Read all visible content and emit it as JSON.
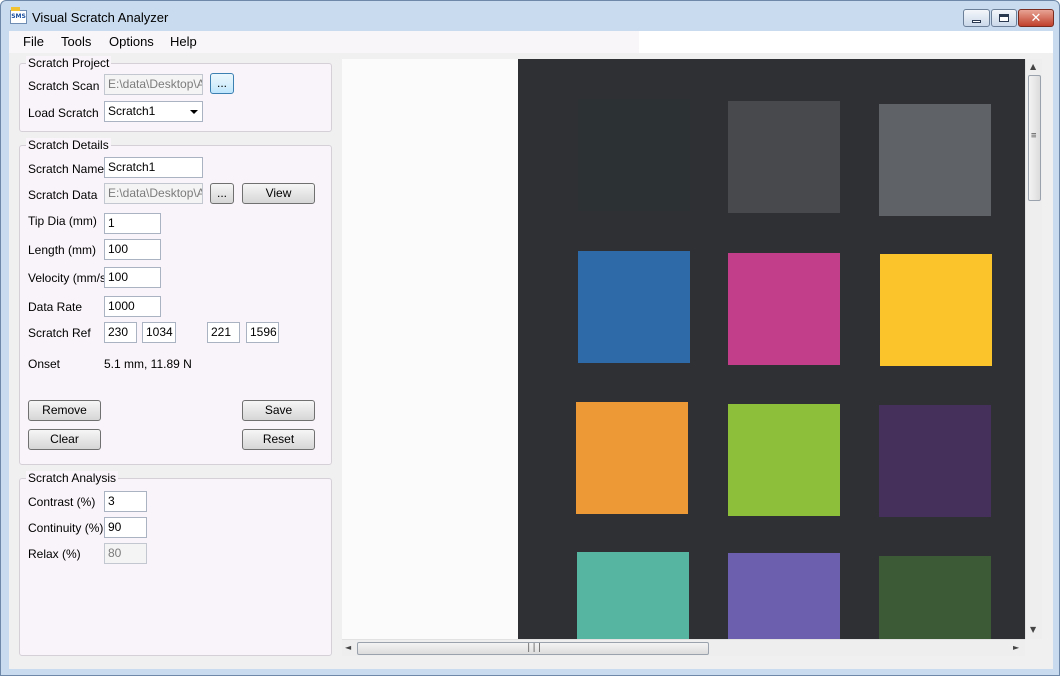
{
  "window": {
    "title": "Visual Scratch Analyzer",
    "icon_text": "SMS",
    "buttons": {
      "minimize": "minimize-icon",
      "maximize": "maximize-icon",
      "close": "✕"
    }
  },
  "menu": {
    "file": "File",
    "tools": "Tools",
    "options": "Options",
    "help": "Help"
  },
  "scratch_project": {
    "legend": "Scratch Project",
    "scan_label": "Scratch Scan",
    "scan_value": "E:\\data\\Desktop\\Al",
    "browse_label": "...",
    "load_label": "Load Scratch",
    "load_value": "Scratch1"
  },
  "scratch_details": {
    "legend": "Scratch Details",
    "name_label": "Scratch Name",
    "name_value": "Scratch1",
    "data_label": "Scratch Data",
    "data_value": "E:\\data\\Desktop\\Al",
    "data_browse_label": "...",
    "view_label": "View",
    "tip_label": "Tip Dia (mm)",
    "tip_value": "1",
    "length_label": "Length (mm)",
    "length_value": "100",
    "velocity_label": "Velocity (mm/s)",
    "velocity_value": "100",
    "rate_label": "Data Rate",
    "rate_value": "1000",
    "ref_label": "Scratch Ref",
    "ref_values": [
      "230",
      "1034",
      "221",
      "1596"
    ],
    "onset_label": "Onset",
    "onset_value": "5.1 mm, 11.89 N",
    "remove_label": "Remove",
    "save_label": "Save",
    "clear_label": "Clear",
    "reset_label": "Reset"
  },
  "scratch_analysis": {
    "legend": "Scratch Analysis",
    "contrast_label": "Contrast (%)",
    "contrast_value": "3",
    "continuity_label": "Continuity (%)",
    "continuity_value": "90",
    "relax_label": "Relax (%)",
    "relax_value": "80"
  },
  "scroll": {
    "up": "▲",
    "down": "▼",
    "left": "◄",
    "right": "►",
    "grip_h": "|||",
    "grip_v": "≡"
  },
  "colors": {
    "board": "#2e3034",
    "patches": [
      "#2c3134",
      "#47494d",
      "#5f6266",
      "#2f6aa8",
      "#c23d8a",
      "#fbc42a",
      "#ed9a36",
      "#8dbf3a",
      "#44305a",
      "#55b5a1",
      "#6c5fae",
      "#3c5a35"
    ]
  }
}
